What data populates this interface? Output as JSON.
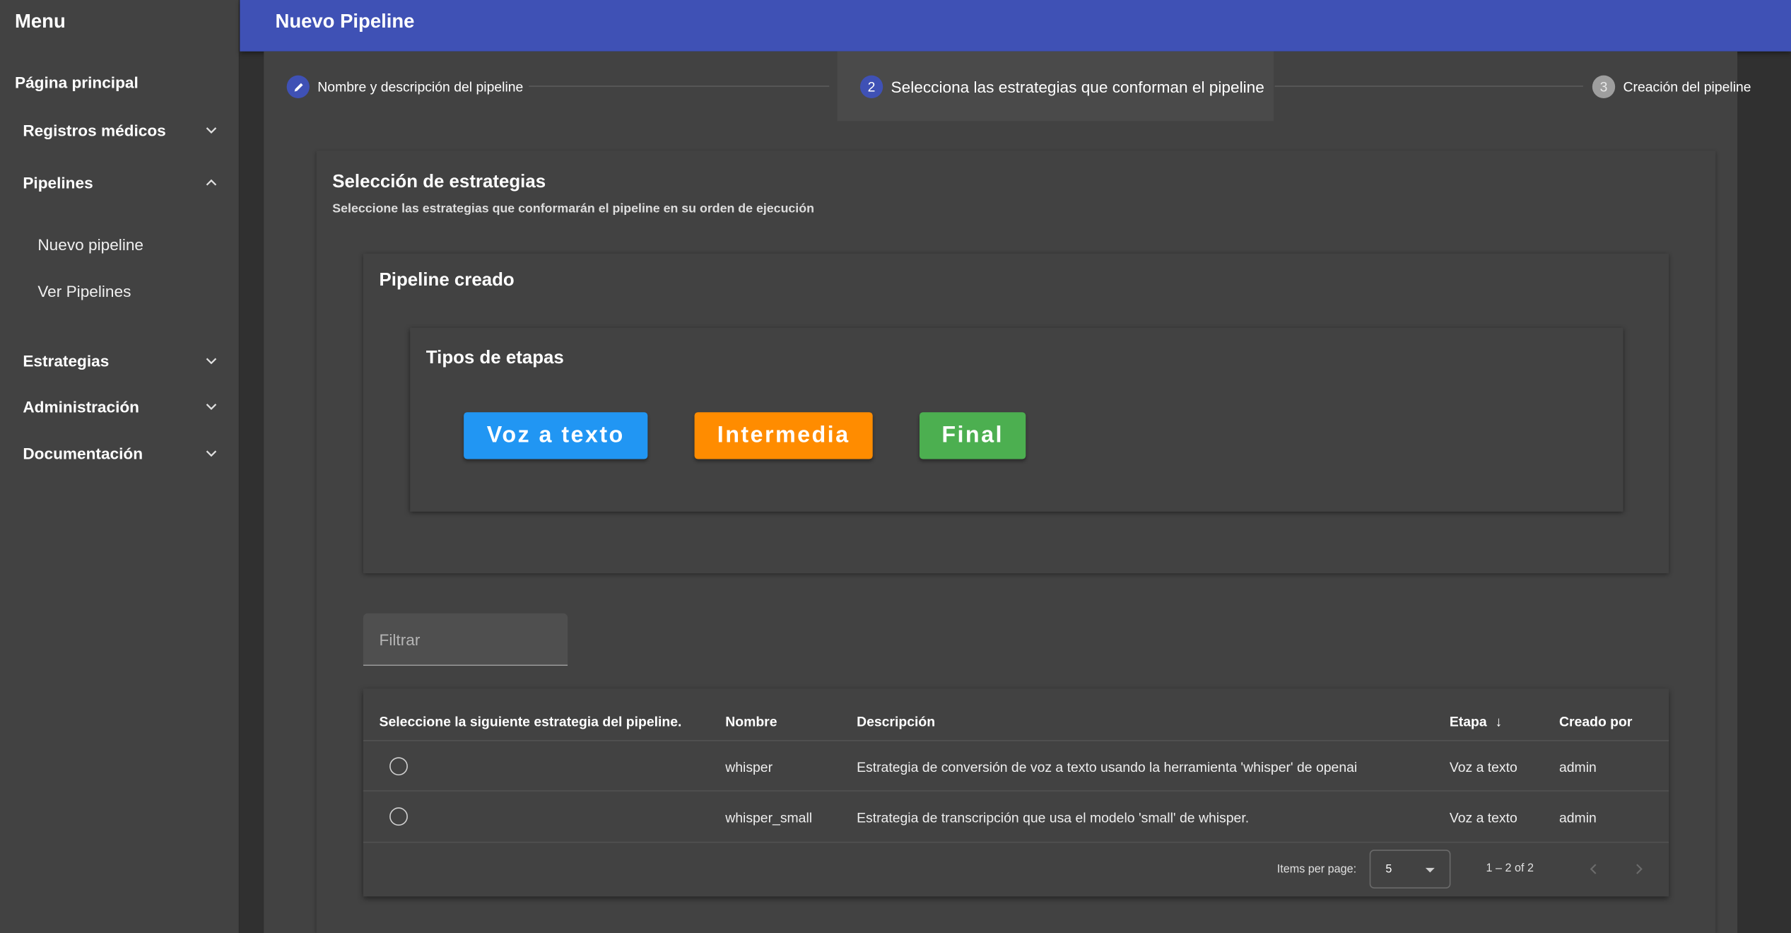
{
  "sidebar": {
    "menu_title": "Menu",
    "home": "Página principal",
    "groups": {
      "medical": "Registros médicos",
      "pipelines": "Pipelines",
      "strategies": "Estrategias",
      "admin": "Administración",
      "docs": "Documentación"
    },
    "pipeline_items": [
      "Nuevo pipeline",
      "Ver Pipelines"
    ]
  },
  "header": {
    "title": "Nuevo Pipeline"
  },
  "stepper": {
    "steps": [
      {
        "label": "Nombre y descripción del pipeline",
        "state": "edit"
      },
      {
        "label": "Selecciona las estrategias que conforman el pipeline",
        "number": "2",
        "state": "active"
      },
      {
        "label": "Creación del pipeline",
        "number": "3",
        "state": "pending"
      }
    ]
  },
  "selection": {
    "title": "Selección de estrategias",
    "subtitle": "Seleccione las estrategias que conformarán el pipeline en su orden de ejecución"
  },
  "pipeline_card": {
    "title": "Pipeline creado"
  },
  "stage_types": {
    "title": "Tipos de etapas",
    "items": [
      {
        "label": "Voz a texto",
        "color": "#2196f3"
      },
      {
        "label": "Intermedia",
        "color": "#ff8c00"
      },
      {
        "label": "Final",
        "color": "#4caf50"
      }
    ]
  },
  "filter": {
    "placeholder": "Filtrar",
    "value": ""
  },
  "table": {
    "columns": {
      "select": "Seleccione la siguiente estrategia del pipeline.",
      "name": "Nombre",
      "description": "Descripción",
      "stage": "Etapa",
      "created_by": "Creado por"
    },
    "sort_indicator": "↓",
    "rows": [
      {
        "name": "whisper",
        "description": "Estrategia de conversión de voz a texto usando la herramienta 'whisper' de openai",
        "stage": "Voz a texto",
        "created_by": "admin",
        "selected": false
      },
      {
        "name": "whisper_small",
        "description": "Estrategia de transcripción que usa el modelo 'small' de whisper.",
        "stage": "Voz a texto",
        "created_by": "admin",
        "selected": false
      }
    ]
  },
  "paginator": {
    "items_per_page_label": "Items per page:",
    "page_size": "5",
    "range": "1 – 2 of 2"
  },
  "colors": {
    "primary": "#3f51b5",
    "background": "#303030",
    "surface": "#424242"
  }
}
